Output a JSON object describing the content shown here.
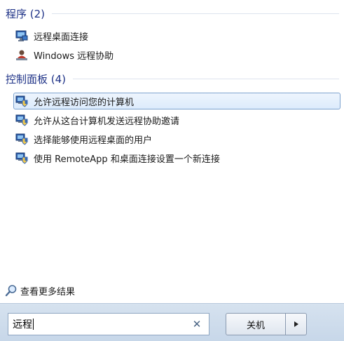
{
  "sections": [
    {
      "title": "程序 (2)",
      "items": [
        {
          "label": "远程桌面连接",
          "icon": "remote-desktop-icon"
        },
        {
          "label": "Windows 远程协助",
          "icon": "remote-assistance-icon"
        }
      ]
    },
    {
      "title": "控制面板 (4)",
      "items": [
        {
          "label": "允许远程访问您的计算机",
          "icon": "control-panel-shield-icon"
        },
        {
          "label": "允许从这台计算机发送远程协助邀请",
          "icon": "control-panel-shield-icon"
        },
        {
          "label": "选择能够使用远程桌面的用户",
          "icon": "control-panel-shield-icon"
        },
        {
          "label": "使用 RemoteApp 和桌面连接设置一个新连接",
          "icon": "control-panel-shield-icon"
        }
      ]
    }
  ],
  "see_more": {
    "label": "查看更多结果",
    "icon": "magnifier-icon"
  },
  "search": {
    "value": "远程",
    "clear_icon": "close-icon"
  },
  "shutdown": {
    "label": "关机",
    "arrow_icon": "triangle-right-icon"
  },
  "colors": {
    "section_title": "#1e3287",
    "selection_border": "#7da2ce",
    "selection_fill": "#dcebfc"
  }
}
